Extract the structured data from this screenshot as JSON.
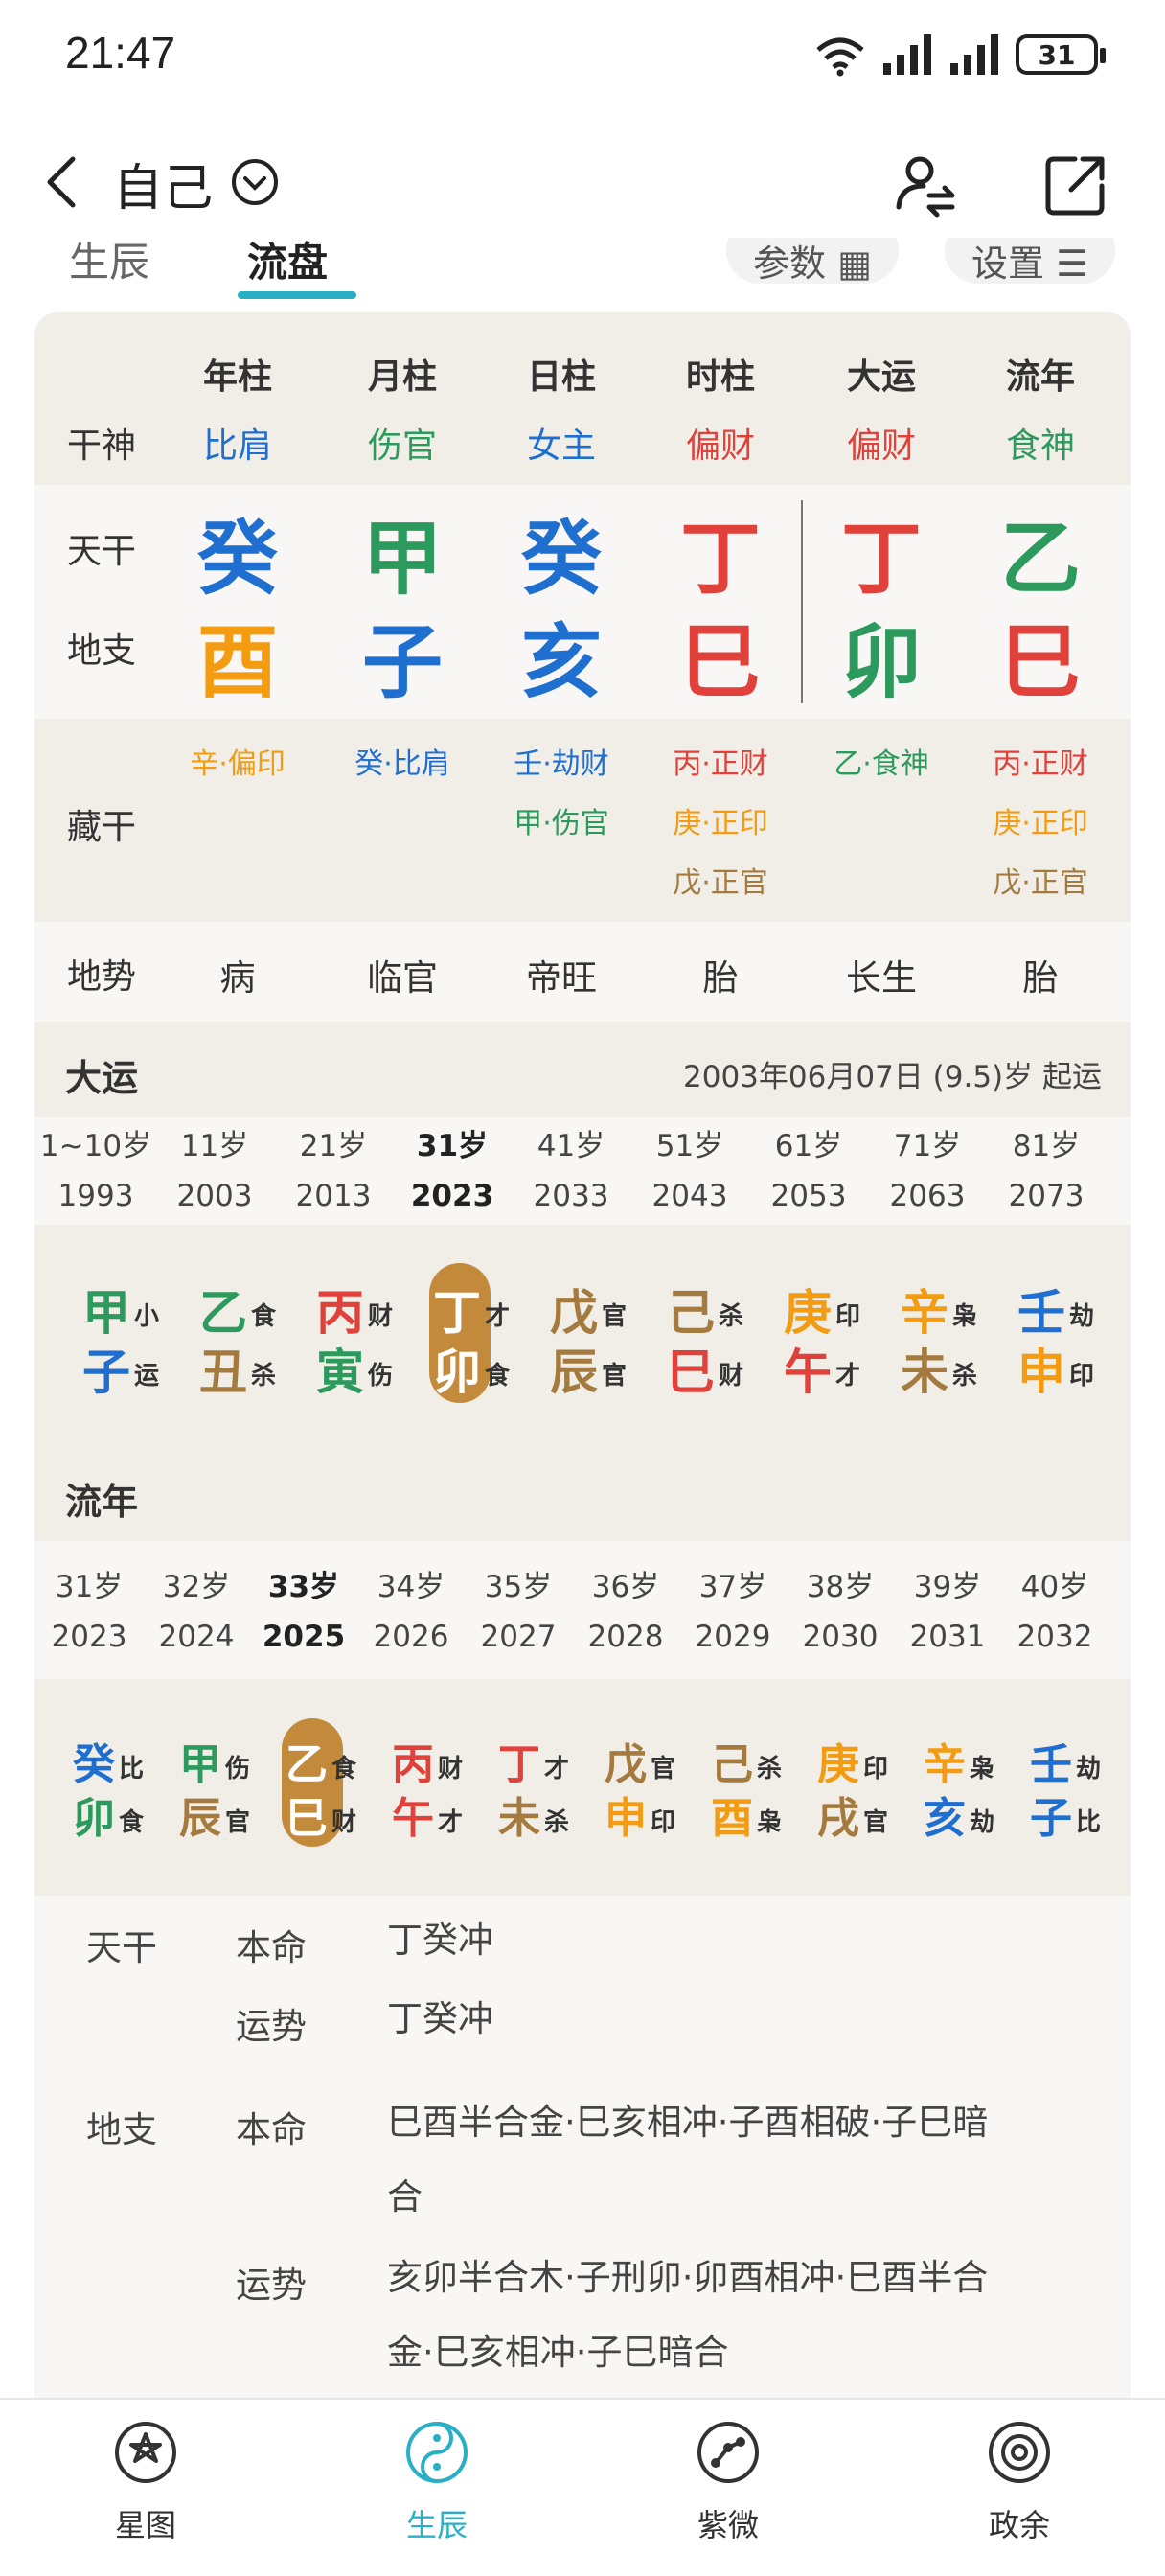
{
  "colors": {
    "blue": "#1f6fd1",
    "green": "#2b9a5c",
    "red": "#e0413b",
    "orange": "#f39c12",
    "brown": "#a57a3f",
    "accent": "#2ab0c6",
    "highlight": "#c48a3c"
  },
  "status": {
    "time": "21:47",
    "battery": "31"
  },
  "header": {
    "title": "自己",
    "icons": [
      "back-icon",
      "chevron-down-icon",
      "person-switch-icon",
      "share-icon"
    ]
  },
  "tabs": [
    "生辰",
    "流盘"
  ],
  "active_tab": "流盘",
  "pills": [
    "参数",
    "设置"
  ],
  "pillars": {
    "headers": [
      "年柱",
      "月柱",
      "日柱",
      "时柱",
      "大运",
      "流年"
    ],
    "labels": {
      "shen": "干神",
      "stem": "天干",
      "branch": "地支",
      "hidden": "藏干",
      "dishi": "地势"
    },
    "shen": [
      {
        "t": "比肩",
        "c": "blue"
      },
      {
        "t": "伤官",
        "c": "green"
      },
      {
        "t": "女主",
        "c": "blue"
      },
      {
        "t": "偏财",
        "c": "red"
      },
      {
        "t": "偏财",
        "c": "red"
      },
      {
        "t": "食神",
        "c": "green"
      }
    ],
    "stems": [
      {
        "t": "癸",
        "c": "blue"
      },
      {
        "t": "甲",
        "c": "green"
      },
      {
        "t": "癸",
        "c": "blue"
      },
      {
        "t": "丁",
        "c": "red"
      },
      {
        "t": "丁",
        "c": "red"
      },
      {
        "t": "乙",
        "c": "green"
      }
    ],
    "branches": [
      {
        "t": "酉",
        "c": "orange"
      },
      {
        "t": "子",
        "c": "blue"
      },
      {
        "t": "亥",
        "c": "blue"
      },
      {
        "t": "巳",
        "c": "red"
      },
      {
        "t": "卯",
        "c": "green"
      },
      {
        "t": "巳",
        "c": "red"
      }
    ],
    "hidden": [
      [
        {
          "t": "辛·偏印",
          "c": "orange"
        }
      ],
      [
        {
          "t": "癸·比肩",
          "c": "blue"
        }
      ],
      [
        {
          "t": "壬·劫财",
          "c": "blue"
        },
        {
          "t": "甲·伤官",
          "c": "green"
        }
      ],
      [
        {
          "t": "丙·正财",
          "c": "red"
        },
        {
          "t": "庚·正印",
          "c": "orange"
        },
        {
          "t": "戊·正官",
          "c": "brown"
        }
      ],
      [
        {
          "t": "乙·食神",
          "c": "green"
        }
      ],
      [
        {
          "t": "丙·正财",
          "c": "red"
        },
        {
          "t": "庚·正印",
          "c": "orange"
        },
        {
          "t": "戊·正官",
          "c": "brown"
        }
      ]
    ],
    "dishi": [
      "病",
      "临官",
      "帝旺",
      "胎",
      "长生",
      "胎"
    ]
  },
  "dayun": {
    "title": "大运",
    "start": "2003年06月07日 (9.5)岁 起运",
    "ages": [
      "1~10岁",
      "11岁",
      "21岁",
      "31岁",
      "41岁",
      "51岁",
      "61岁",
      "71岁",
      "81岁"
    ],
    "years": [
      "1993",
      "2003",
      "2013",
      "2023",
      "2033",
      "2043",
      "2053",
      "2063",
      "2073"
    ],
    "current": 3,
    "gz": [
      {
        "s": "甲",
        "sc": "green",
        "st": "小",
        "b": "子",
        "bc": "blue",
        "bt": "运"
      },
      {
        "s": "乙",
        "sc": "green",
        "st": "食",
        "b": "丑",
        "bc": "brown",
        "bt": "杀"
      },
      {
        "s": "丙",
        "sc": "red",
        "st": "财",
        "b": "寅",
        "bc": "green",
        "bt": "伤"
      },
      {
        "s": "丁",
        "sc": "red",
        "st": "才",
        "b": "卯",
        "bc": "green",
        "bt": "食"
      },
      {
        "s": "戊",
        "sc": "brown",
        "st": "官",
        "b": "辰",
        "bc": "brown",
        "bt": "官"
      },
      {
        "s": "己",
        "sc": "brown",
        "st": "杀",
        "b": "巳",
        "bc": "red",
        "bt": "财"
      },
      {
        "s": "庚",
        "sc": "orange",
        "st": "印",
        "b": "午",
        "bc": "red",
        "bt": "才"
      },
      {
        "s": "辛",
        "sc": "orange",
        "st": "枭",
        "b": "未",
        "bc": "brown",
        "bt": "杀"
      },
      {
        "s": "壬",
        "sc": "blue",
        "st": "劫",
        "b": "申",
        "bc": "orange",
        "bt": "印"
      }
    ]
  },
  "liunian": {
    "title": "流年",
    "ages": [
      "31岁",
      "32岁",
      "33岁",
      "34岁",
      "35岁",
      "36岁",
      "37岁",
      "38岁",
      "39岁",
      "40岁"
    ],
    "years": [
      "2023",
      "2024",
      "2025",
      "2026",
      "2027",
      "2028",
      "2029",
      "2030",
      "2031",
      "2032"
    ],
    "current": 2,
    "gz": [
      {
        "s": "癸",
        "sc": "blue",
        "st": "比",
        "b": "卯",
        "bc": "green",
        "bt": "食"
      },
      {
        "s": "甲",
        "sc": "green",
        "st": "伤",
        "b": "辰",
        "bc": "brown",
        "bt": "官"
      },
      {
        "s": "乙",
        "sc": "green",
        "st": "食",
        "b": "巳",
        "bc": "red",
        "bt": "财"
      },
      {
        "s": "丙",
        "sc": "red",
        "st": "财",
        "b": "午",
        "bc": "red",
        "bt": "才"
      },
      {
        "s": "丁",
        "sc": "red",
        "st": "才",
        "b": "未",
        "bc": "brown",
        "bt": "杀"
      },
      {
        "s": "戊",
        "sc": "brown",
        "st": "官",
        "b": "申",
        "bc": "orange",
        "bt": "印"
      },
      {
        "s": "己",
        "sc": "brown",
        "st": "杀",
        "b": "酉",
        "bc": "orange",
        "bt": "枭"
      },
      {
        "s": "庚",
        "sc": "orange",
        "st": "印",
        "b": "戌",
        "bc": "brown",
        "bt": "官"
      },
      {
        "s": "辛",
        "sc": "orange",
        "st": "枭",
        "b": "亥",
        "bc": "blue",
        "bt": "劫"
      },
      {
        "s": "壬",
        "sc": "blue",
        "st": "劫",
        "b": "子",
        "bc": "blue",
        "bt": "比"
      }
    ]
  },
  "relations": {
    "tiangan": {
      "label": "天干",
      "benming_label": "本命",
      "benming": "丁癸冲",
      "yunshi_label": "运势",
      "yunshi": "丁癸冲"
    },
    "dizhi": {
      "label": "地支",
      "benming_label": "本命",
      "benming": [
        "巳酉半合金·巳亥相冲·子酉相破·子巳暗",
        "合"
      ],
      "yunshi_label": "运势",
      "yunshi": [
        "亥卯半合木·子刑卯·卯酉相冲·巳酉半合",
        "金·巳亥相冲·子巳暗合"
      ]
    }
  },
  "bottom_nav": [
    {
      "label": "星图",
      "icon": "star-chart-icon"
    },
    {
      "label": "生辰",
      "icon": "yin-yang-icon"
    },
    {
      "label": "紫微",
      "icon": "ziwei-icon"
    },
    {
      "label": "政余",
      "icon": "dial-icon"
    }
  ],
  "bottom_nav_active": 1
}
